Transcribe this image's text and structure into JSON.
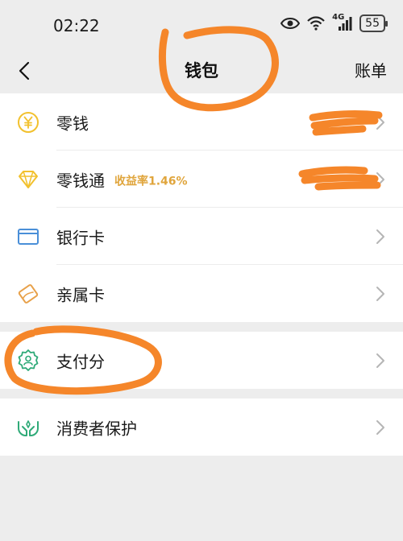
{
  "status": {
    "time": "02:22",
    "network": "4G",
    "battery": "55"
  },
  "nav": {
    "title": "钱包",
    "right_label": "账单"
  },
  "groups": [
    {
      "items": [
        {
          "label": "零钱",
          "icon": "yuan-coin-icon"
        },
        {
          "label": "零钱通",
          "tag": "收益率1.46%",
          "icon": "diamond-icon"
        },
        {
          "label": "银行卡",
          "icon": "bank-card-icon"
        },
        {
          "label": "亲属卡",
          "icon": "family-card-icon"
        }
      ]
    },
    {
      "items": [
        {
          "label": "支付分",
          "icon": "payscore-badge-icon"
        }
      ]
    },
    {
      "items": [
        {
          "label": "消费者保护",
          "icon": "protection-hands-icon"
        }
      ]
    }
  ],
  "colors": {
    "page_bg": "#ededed",
    "row_bg": "#ffffff",
    "yield_tag": "#e0a53c",
    "icon_yellow": "#f2c12e",
    "icon_blue": "#4a8fd8",
    "icon_orange": "#e8a14a",
    "icon_green": "#2faa78",
    "annotation_orange": "#f5862a"
  }
}
